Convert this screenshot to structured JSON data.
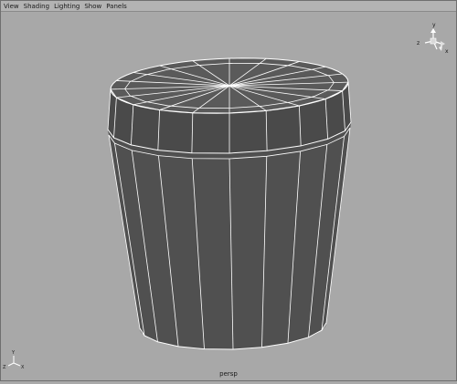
{
  "menubar": {
    "items": [
      "View",
      "Shading",
      "Lighting",
      "Show",
      "Panels"
    ]
  },
  "viewport": {
    "camera_label": "persp",
    "background_color": "#a8a8a8",
    "mesh_fill_color": "#505050",
    "wireframe_color": "#ffffff"
  },
  "view_cube": {
    "axes": {
      "y": "y",
      "z": "z",
      "x": "x"
    }
  },
  "axis_indicator": {
    "axes": {
      "y": "Y",
      "z": "Z",
      "x": "X"
    }
  }
}
